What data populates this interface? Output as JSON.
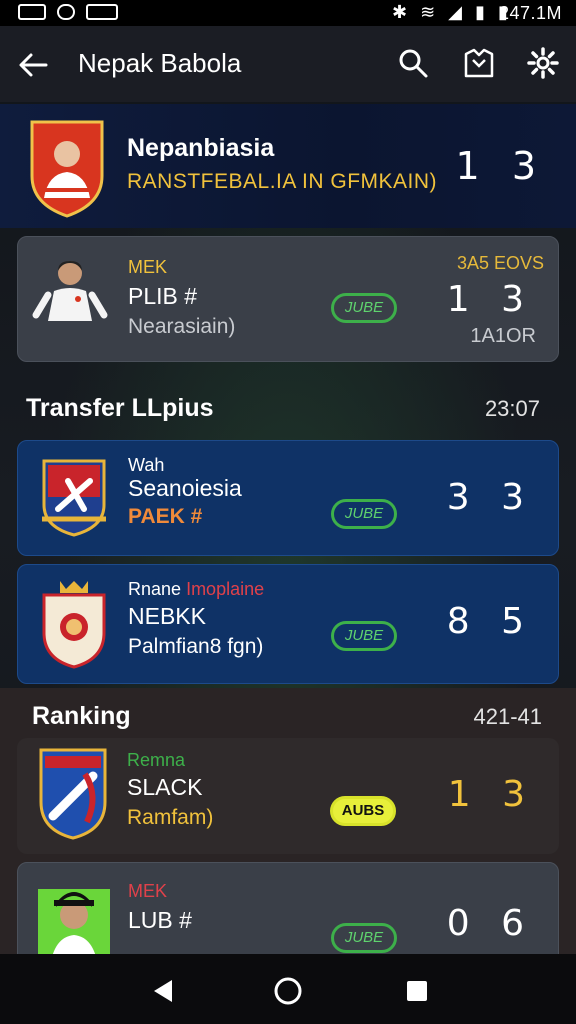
{
  "status_bar": {
    "time": "247.1M"
  },
  "app_bar": {
    "title": "Nepak Babola",
    "icons": [
      "back-arrow-icon",
      "search-icon",
      "kit-icon",
      "gear-icon"
    ]
  },
  "header": {
    "name": "Nepanbiasia",
    "subtitle": "RANSTFEBAL.IA IN GFMKAIN)",
    "score_home": "1",
    "score_away": "3"
  },
  "featured_card": {
    "tag": "MEK",
    "name": "PLIB #",
    "sub": "Nearasiain)",
    "pill": "JUBE",
    "right_top": "3A5 EOVS",
    "score_home": "1",
    "score_away": "3",
    "right_bottom": "1A1OR"
  },
  "transfer_section": {
    "title": "Transfer LLpius",
    "right": "23:07"
  },
  "transfer_items": [
    {
      "tag": "Wah",
      "name": "Seanoiesia",
      "sub": "PAEK #",
      "pill": "JUBE",
      "score_home": "3",
      "score_away": "3"
    },
    {
      "tag_a": "Rnane",
      "tag_b": "Imoplaine",
      "name": "NEBKK",
      "sub": "Palmfian8 fgn)",
      "pill": "JUBE",
      "score_home": "8",
      "score_away": "5"
    }
  ],
  "ranking_section": {
    "title": "Ranking",
    "right": "421-41"
  },
  "ranking_items": [
    {
      "tag": "Remna",
      "name": "SLACK",
      "sub": "Ramfam)",
      "pill": "AUBS",
      "score_home": "1",
      "score_away": "3"
    },
    {
      "tag": "MEK",
      "name": "LUB #",
      "pill": "JUBE",
      "score_home": "0",
      "score_away": "6"
    }
  ],
  "colors": {
    "accent_yellow": "#f1c23c",
    "pill_green": "#3db04a",
    "card_blue": "#0f3266",
    "card_gray": "#3a3f48"
  }
}
